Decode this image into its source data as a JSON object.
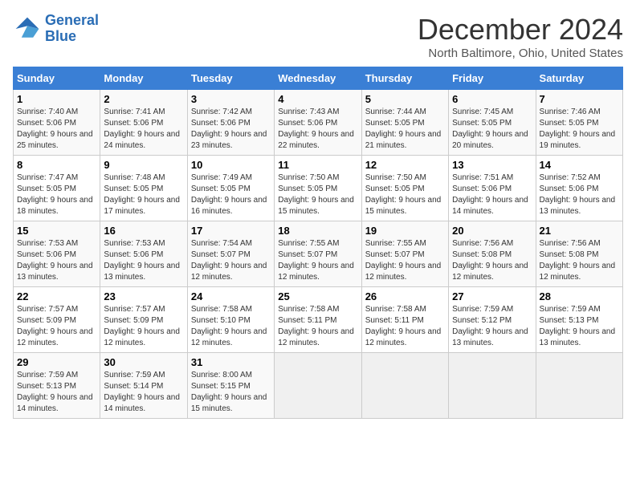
{
  "logo": {
    "line1": "General",
    "line2": "Blue"
  },
  "title": "December 2024",
  "subtitle": "North Baltimore, Ohio, United States",
  "days_of_week": [
    "Sunday",
    "Monday",
    "Tuesday",
    "Wednesday",
    "Thursday",
    "Friday",
    "Saturday"
  ],
  "weeks": [
    [
      {
        "day": 1,
        "sunrise": "7:40 AM",
        "sunset": "5:06 PM",
        "daylight": "9 hours and 25 minutes."
      },
      {
        "day": 2,
        "sunrise": "7:41 AM",
        "sunset": "5:06 PM",
        "daylight": "9 hours and 24 minutes."
      },
      {
        "day": 3,
        "sunrise": "7:42 AM",
        "sunset": "5:06 PM",
        "daylight": "9 hours and 23 minutes."
      },
      {
        "day": 4,
        "sunrise": "7:43 AM",
        "sunset": "5:06 PM",
        "daylight": "9 hours and 22 minutes."
      },
      {
        "day": 5,
        "sunrise": "7:44 AM",
        "sunset": "5:05 PM",
        "daylight": "9 hours and 21 minutes."
      },
      {
        "day": 6,
        "sunrise": "7:45 AM",
        "sunset": "5:05 PM",
        "daylight": "9 hours and 20 minutes."
      },
      {
        "day": 7,
        "sunrise": "7:46 AM",
        "sunset": "5:05 PM",
        "daylight": "9 hours and 19 minutes."
      }
    ],
    [
      {
        "day": 8,
        "sunrise": "7:47 AM",
        "sunset": "5:05 PM",
        "daylight": "9 hours and 18 minutes."
      },
      {
        "day": 9,
        "sunrise": "7:48 AM",
        "sunset": "5:05 PM",
        "daylight": "9 hours and 17 minutes."
      },
      {
        "day": 10,
        "sunrise": "7:49 AM",
        "sunset": "5:05 PM",
        "daylight": "9 hours and 16 minutes."
      },
      {
        "day": 11,
        "sunrise": "7:50 AM",
        "sunset": "5:05 PM",
        "daylight": "9 hours and 15 minutes."
      },
      {
        "day": 12,
        "sunrise": "7:50 AM",
        "sunset": "5:05 PM",
        "daylight": "9 hours and 15 minutes."
      },
      {
        "day": 13,
        "sunrise": "7:51 AM",
        "sunset": "5:06 PM",
        "daylight": "9 hours and 14 minutes."
      },
      {
        "day": 14,
        "sunrise": "7:52 AM",
        "sunset": "5:06 PM",
        "daylight": "9 hours and 13 minutes."
      }
    ],
    [
      {
        "day": 15,
        "sunrise": "7:53 AM",
        "sunset": "5:06 PM",
        "daylight": "9 hours and 13 minutes."
      },
      {
        "day": 16,
        "sunrise": "7:53 AM",
        "sunset": "5:06 PM",
        "daylight": "9 hours and 13 minutes."
      },
      {
        "day": 17,
        "sunrise": "7:54 AM",
        "sunset": "5:07 PM",
        "daylight": "9 hours and 12 minutes."
      },
      {
        "day": 18,
        "sunrise": "7:55 AM",
        "sunset": "5:07 PM",
        "daylight": "9 hours and 12 minutes."
      },
      {
        "day": 19,
        "sunrise": "7:55 AM",
        "sunset": "5:07 PM",
        "daylight": "9 hours and 12 minutes."
      },
      {
        "day": 20,
        "sunrise": "7:56 AM",
        "sunset": "5:08 PM",
        "daylight": "9 hours and 12 minutes."
      },
      {
        "day": 21,
        "sunrise": "7:56 AM",
        "sunset": "5:08 PM",
        "daylight": "9 hours and 12 minutes."
      }
    ],
    [
      {
        "day": 22,
        "sunrise": "7:57 AM",
        "sunset": "5:09 PM",
        "daylight": "9 hours and 12 minutes."
      },
      {
        "day": 23,
        "sunrise": "7:57 AM",
        "sunset": "5:09 PM",
        "daylight": "9 hours and 12 minutes."
      },
      {
        "day": 24,
        "sunrise": "7:58 AM",
        "sunset": "5:10 PM",
        "daylight": "9 hours and 12 minutes."
      },
      {
        "day": 25,
        "sunrise": "7:58 AM",
        "sunset": "5:11 PM",
        "daylight": "9 hours and 12 minutes."
      },
      {
        "day": 26,
        "sunrise": "7:58 AM",
        "sunset": "5:11 PM",
        "daylight": "9 hours and 12 minutes."
      },
      {
        "day": 27,
        "sunrise": "7:59 AM",
        "sunset": "5:12 PM",
        "daylight": "9 hours and 13 minutes."
      },
      {
        "day": 28,
        "sunrise": "7:59 AM",
        "sunset": "5:13 PM",
        "daylight": "9 hours and 13 minutes."
      }
    ],
    [
      {
        "day": 29,
        "sunrise": "7:59 AM",
        "sunset": "5:13 PM",
        "daylight": "9 hours and 14 minutes."
      },
      {
        "day": 30,
        "sunrise": "7:59 AM",
        "sunset": "5:14 PM",
        "daylight": "9 hours and 14 minutes."
      },
      {
        "day": 31,
        "sunrise": "8:00 AM",
        "sunset": "5:15 PM",
        "daylight": "9 hours and 15 minutes."
      },
      null,
      null,
      null,
      null
    ]
  ]
}
